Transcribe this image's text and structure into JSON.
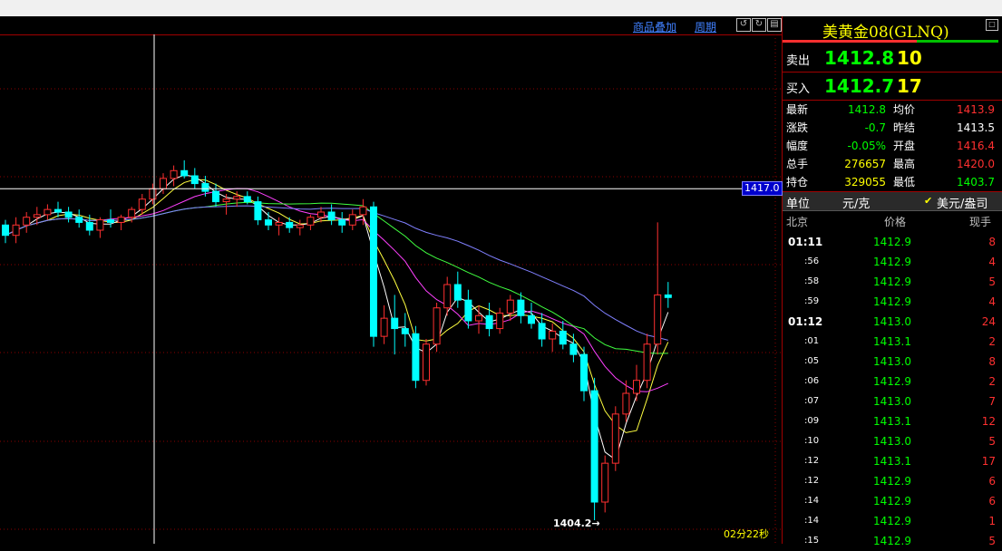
{
  "toolbar": {
    "overlay_label": "商品叠加",
    "period_label": "周期"
  },
  "crosshair": {
    "price_label": "1417.0"
  },
  "low_marker": {
    "label": "1404.2→"
  },
  "timer": "02分22秒",
  "panel": {
    "title": "美黄金08(GLNQ)",
    "sell": {
      "label": "卖出",
      "price": "1412.8",
      "volume": "10"
    },
    "buy": {
      "label": "买入",
      "price": "1412.7",
      "volume": "17"
    },
    "stats": [
      {
        "k": "最新",
        "v": "1412.8",
        "color": "#00ff00"
      },
      {
        "k": "均价",
        "v": "1413.9",
        "color": "#ff3030"
      },
      {
        "k": "涨跌",
        "v": "-0.7",
        "color": "#00ff00"
      },
      {
        "k": "昨结",
        "v": "1413.5",
        "color": "#ffffff"
      },
      {
        "k": "幅度",
        "v": "-0.05%",
        "color": "#00ff00"
      },
      {
        "k": "开盘",
        "v": "1416.4",
        "color": "#ff3030"
      },
      {
        "k": "总手",
        "v": "276657",
        "color": "#ffff00"
      },
      {
        "k": "最高",
        "v": "1420.0",
        "color": "#ff3030"
      },
      {
        "k": "持仓",
        "v": "329055",
        "color": "#ffff00"
      },
      {
        "k": "最低",
        "v": "1403.7",
        "color": "#00ff00"
      }
    ],
    "unit_label": "单位",
    "unit_value": "元/克",
    "unit_alt": "美元/盎司",
    "tick_header": {
      "market": "北京",
      "price": "价格",
      "volume": "现手"
    },
    "ticks": [
      {
        "t": "01:11",
        "p": "1412.9",
        "v": "8",
        "full": true
      },
      {
        "t": ":56",
        "p": "1412.9",
        "v": "4",
        "full": false
      },
      {
        "t": ":58",
        "p": "1412.9",
        "v": "5",
        "full": false
      },
      {
        "t": ":59",
        "p": "1412.9",
        "v": "4",
        "full": false
      },
      {
        "t": "01:12",
        "p": "1413.0",
        "v": "24",
        "full": true
      },
      {
        "t": ":01",
        "p": "1413.1",
        "v": "2",
        "full": false
      },
      {
        "t": ":05",
        "p": "1413.0",
        "v": "8",
        "full": false
      },
      {
        "t": ":06",
        "p": "1412.9",
        "v": "2",
        "full": false
      },
      {
        "t": ":07",
        "p": "1413.0",
        "v": "7",
        "full": false
      },
      {
        "t": ":09",
        "p": "1413.1",
        "v": "12",
        "full": false
      },
      {
        "t": ":10",
        "p": "1413.0",
        "v": "5",
        "full": false
      },
      {
        "t": ":12",
        "p": "1413.1",
        "v": "17",
        "full": false
      },
      {
        "t": ":12",
        "p": "1412.9",
        "v": "6",
        "full": false
      },
      {
        "t": ":14",
        "p": "1412.9",
        "v": "6",
        "full": false
      },
      {
        "t": ":14",
        "p": "1412.9",
        "v": "1",
        "full": false
      },
      {
        "t": ":15",
        "p": "1412.9",
        "v": "5",
        "full": false
      }
    ]
  },
  "chart_data": {
    "type": "candlestick",
    "grid": "horizontal-dotted",
    "crosshair_price": 1417.0,
    "low_price": 1404.2,
    "candles": [
      [
        1415.6,
        1415.8,
        1414.9,
        1415.2
      ],
      [
        1415.2,
        1415.9,
        1414.9,
        1415.6
      ],
      [
        1415.6,
        1416.1,
        1415.3,
        1415.9
      ],
      [
        1415.9,
        1416.3,
        1415.6,
        1416.0
      ],
      [
        1416.0,
        1416.4,
        1415.8,
        1416.2
      ],
      [
        1416.2,
        1416.5,
        1415.9,
        1416.1
      ],
      [
        1416.1,
        1416.3,
        1415.7,
        1415.9
      ],
      [
        1415.9,
        1416.2,
        1415.5,
        1415.7
      ],
      [
        1415.7,
        1416.0,
        1415.2,
        1415.4
      ],
      [
        1415.4,
        1415.9,
        1415.1,
        1415.8
      ],
      [
        1415.8,
        1416.2,
        1415.5,
        1415.7
      ],
      [
        1415.7,
        1416.0,
        1415.4,
        1415.9
      ],
      [
        1415.9,
        1416.3,
        1415.7,
        1416.2
      ],
      [
        1416.2,
        1416.8,
        1416.0,
        1416.6
      ],
      [
        1416.6,
        1417.2,
        1416.4,
        1417.0
      ],
      [
        1417.0,
        1417.6,
        1416.8,
        1417.4
      ],
      [
        1417.4,
        1417.9,
        1417.1,
        1417.7
      ],
      [
        1417.7,
        1418.1,
        1417.4,
        1417.5
      ],
      [
        1417.5,
        1417.8,
        1417.0,
        1417.2
      ],
      [
        1417.2,
        1417.5,
        1416.7,
        1416.9
      ],
      [
        1416.9,
        1417.2,
        1416.3,
        1416.5
      ],
      [
        1416.5,
        1416.8,
        1416.0,
        1416.6
      ],
      [
        1416.6,
        1416.9,
        1416.3,
        1416.7
      ],
      [
        1416.7,
        1416.9,
        1416.4,
        1416.5
      ],
      [
        1416.5,
        1416.7,
        1415.6,
        1415.8
      ],
      [
        1415.8,
        1416.1,
        1415.4,
        1415.6
      ],
      [
        1415.6,
        1415.9,
        1415.2,
        1415.7
      ],
      [
        1415.7,
        1415.9,
        1415.3,
        1415.5
      ],
      [
        1415.5,
        1415.8,
        1415.2,
        1415.6
      ],
      [
        1415.6,
        1416.0,
        1415.4,
        1415.9
      ],
      [
        1415.9,
        1416.3,
        1415.7,
        1416.1
      ],
      [
        1416.1,
        1416.4,
        1415.6,
        1415.8
      ],
      [
        1415.8,
        1416.1,
        1415.3,
        1415.6
      ],
      [
        1415.6,
        1416.2,
        1415.4,
        1416.0
      ],
      [
        1416.0,
        1416.6,
        1415.6,
        1416.3
      ],
      [
        1416.3,
        1416.5,
        1410.9,
        1411.3
      ],
      [
        1411.3,
        1412.5,
        1411.0,
        1412.0
      ],
      [
        1412.0,
        1412.9,
        1410.6,
        1411.6
      ],
      [
        1411.6,
        1412.2,
        1410.9,
        1411.4
      ],
      [
        1411.4,
        1411.7,
        1409.3,
        1409.6
      ],
      [
        1409.6,
        1411.2,
        1409.4,
        1411.0
      ],
      [
        1411.0,
        1412.6,
        1410.7,
        1412.4
      ],
      [
        1412.4,
        1413.6,
        1412.1,
        1413.3
      ],
      [
        1413.3,
        1413.8,
        1412.4,
        1412.7
      ],
      [
        1412.7,
        1413.1,
        1411.6,
        1411.9
      ],
      [
        1411.9,
        1412.5,
        1411.4,
        1412.1
      ],
      [
        1412.1,
        1412.6,
        1411.3,
        1411.6
      ],
      [
        1411.6,
        1412.4,
        1411.4,
        1412.2
      ],
      [
        1412.2,
        1412.9,
        1411.9,
        1412.7
      ],
      [
        1412.7,
        1413.0,
        1411.8,
        1412.1
      ],
      [
        1412.1,
        1412.6,
        1411.6,
        1411.8
      ],
      [
        1411.8,
        1412.2,
        1410.9,
        1411.2
      ],
      [
        1411.2,
        1411.8,
        1410.7,
        1411.5
      ],
      [
        1411.5,
        1411.9,
        1410.8,
        1411.0
      ],
      [
        1411.0,
        1411.4,
        1410.3,
        1410.6
      ],
      [
        1410.6,
        1410.9,
        1408.8,
        1409.2
      ],
      [
        1409.2,
        1409.7,
        1404.2,
        1404.9
      ],
      [
        1404.9,
        1406.7,
        1404.5,
        1406.4
      ],
      [
        1406.4,
        1408.6,
        1406.1,
        1408.3
      ],
      [
        1408.3,
        1409.6,
        1408.0,
        1409.1
      ],
      [
        1409.1,
        1410.2,
        1408.8,
        1409.6
      ],
      [
        1409.6,
        1411.4,
        1409.3,
        1411.0
      ],
      [
        1411.0,
        1415.7,
        1410.6,
        1412.9
      ],
      [
        1412.9,
        1413.4,
        1412.4,
        1412.8
      ]
    ],
    "moving_averages": [
      {
        "color": "#ffff40",
        "period": 5
      },
      {
        "color": "#ffffff",
        "period": 3
      },
      {
        "color": "#ff40ff",
        "period": 10
      },
      {
        "color": "#40ff40",
        "period": 20
      },
      {
        "color": "#8080ff",
        "period": 30
      }
    ]
  }
}
